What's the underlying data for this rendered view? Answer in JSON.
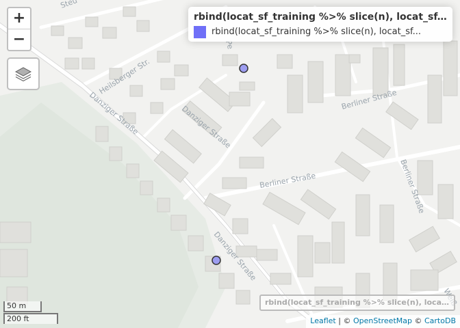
{
  "zoom": {
    "in_label": "+",
    "out_label": "−"
  },
  "legend": {
    "title": "rbind(locat_sf_training %>% slice(n), locat_sf...",
    "label": "rbind(locat_sf_training %>% slice(n), locat_sf...",
    "swatch_color": "#6f6ff7"
  },
  "layer_tag": "rbind(locat_sf_training %>% slice(n), locat_sf...",
  "scale": {
    "metric": "50 m",
    "imperial": "200 ft"
  },
  "attribution": {
    "leaflet": "Leaflet",
    "sep": " | © ",
    "osm": "OpenStreetMap",
    "sep2": " © ",
    "carto": "CartoDB"
  },
  "map_labels": {
    "heilsberger": "Heilsberger Str.",
    "danziger1": "Danziger Straße",
    "danziger2": "Danziger Straße",
    "danziger3": "Danziger Straße",
    "berliner1": "Berliner Straße",
    "berliner2": "Berliner Straße",
    "berliner3": "Berliner Straße",
    "partial1": "Pe",
    "partial2": "Steu",
    "partial3": "Weiß"
  },
  "markers": {
    "fill": "#9d9df0",
    "stroke": "#333333",
    "count": 2
  }
}
